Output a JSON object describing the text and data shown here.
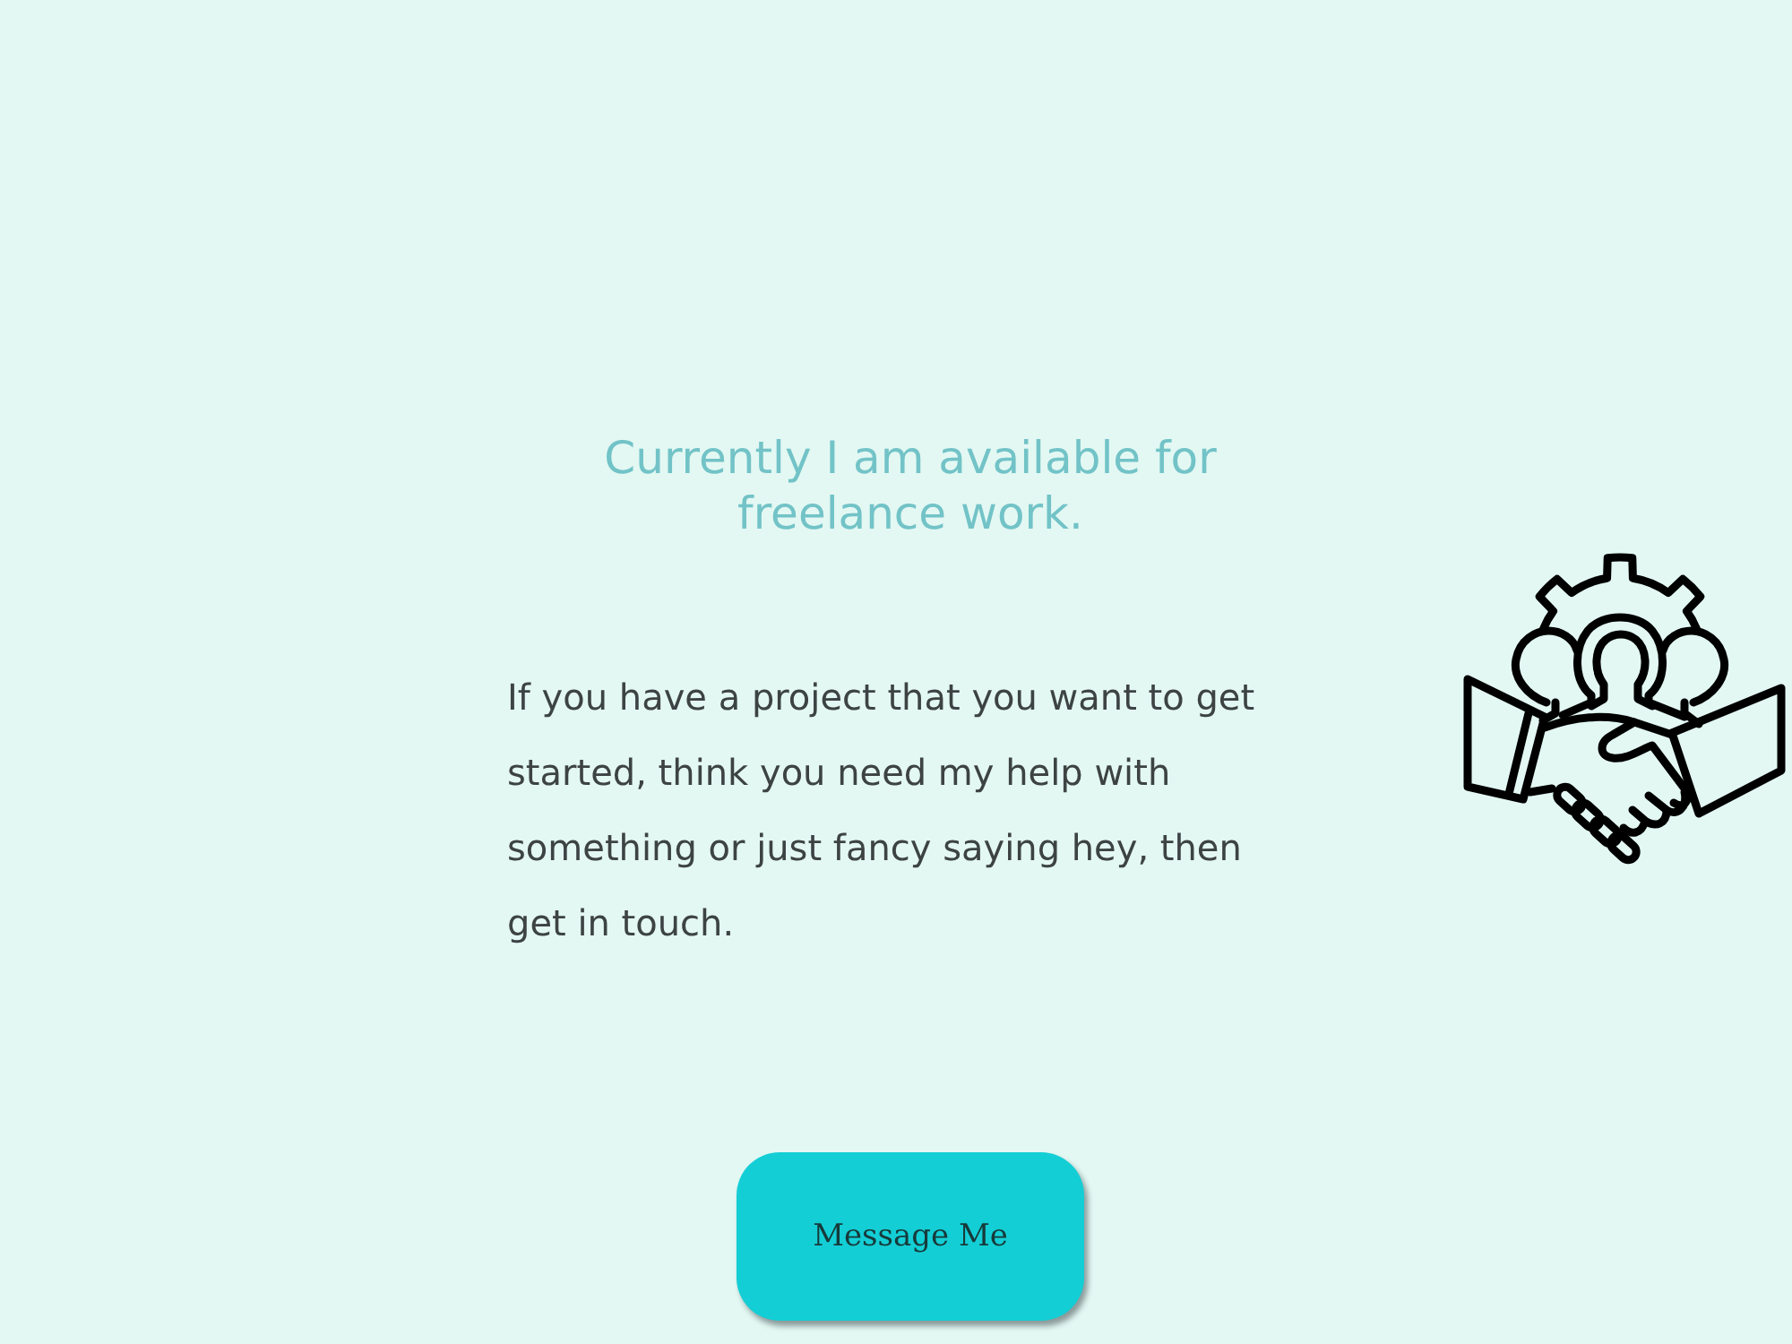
{
  "heading": "Currently I am available for freelance work.",
  "intro": "If you have a project that you want to get started, think you need my help with something or just fancy saying hey, then get in touch.",
  "button": {
    "label": "Message Me"
  }
}
